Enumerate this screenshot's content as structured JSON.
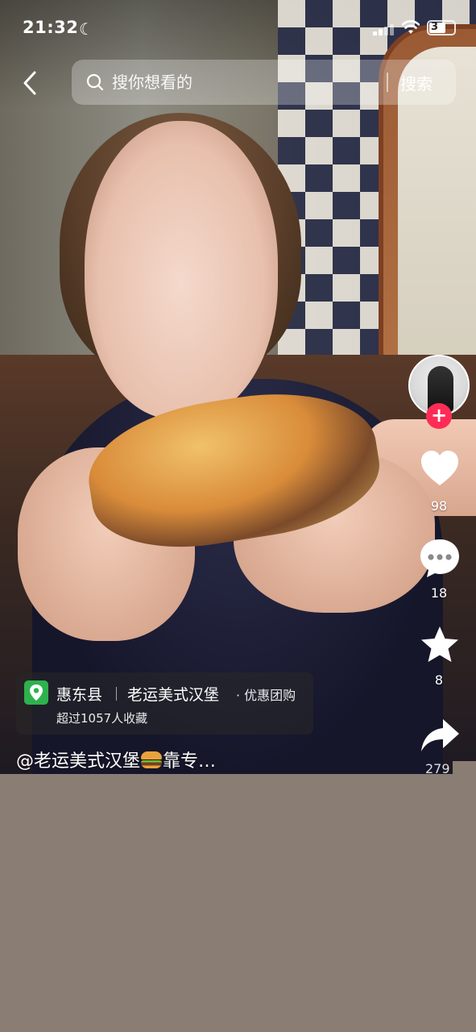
{
  "status_bar": {
    "time": "21:32",
    "battery_level": "34",
    "battery_text": "3"
  },
  "top_bar": {
    "back_icon": "chevron-left-icon",
    "search_placeholder": "搜你想看的",
    "search_button": "搜索"
  },
  "right_rail": {
    "follow_symbol": "+",
    "likes": "98",
    "comments": "18",
    "favorites": "8",
    "shares": "279"
  },
  "poi_card": {
    "county": "惠东县",
    "shop_name": "老运美式汉堡",
    "tag": "· 优惠团购",
    "subtext": "超过1057人收藏"
  },
  "caption": {
    "prefix": "@老运美式汉堡",
    "suffix": "靠专…"
  },
  "colors": {
    "accent_follow": "#fe2c55",
    "poi_pin": "#2db34d",
    "background_lower": "#8a7d74"
  }
}
